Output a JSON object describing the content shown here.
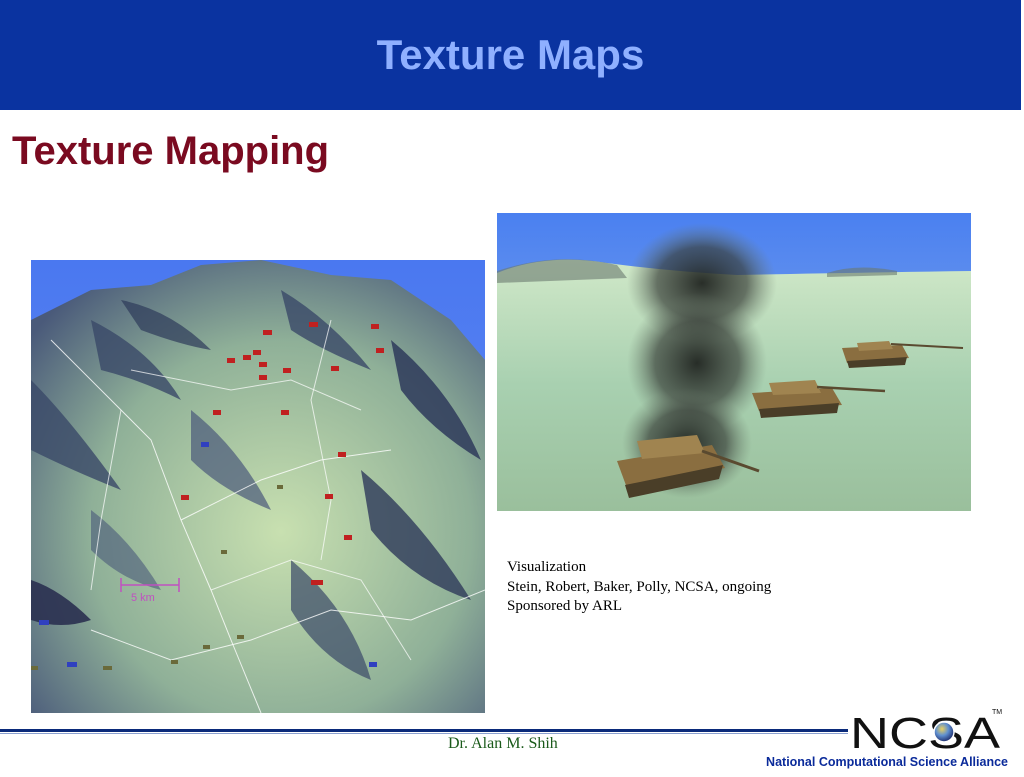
{
  "header": {
    "title": "Texture Maps"
  },
  "slide": {
    "subtitle": "Texture Mapping"
  },
  "caption": {
    "line1": "Visualization",
    "line2": "Stein, Robert, Baker, Polly, NCSA, ongoing",
    "line3": "Sponsored by ARL"
  },
  "terrain_image": {
    "scale_label": "5 km"
  },
  "footer": {
    "presenter": "Dr. Alan M. Shih",
    "logo_text": "NCSA",
    "trademark": "TM",
    "organization": "National Computational Science Alliance"
  },
  "colors": {
    "header_bg": "#0a33a0",
    "header_text": "#8fb0ff",
    "subtitle": "#7a0a20",
    "org_text": "#0a2a9a",
    "presenter_text": "#1a5a1a"
  }
}
